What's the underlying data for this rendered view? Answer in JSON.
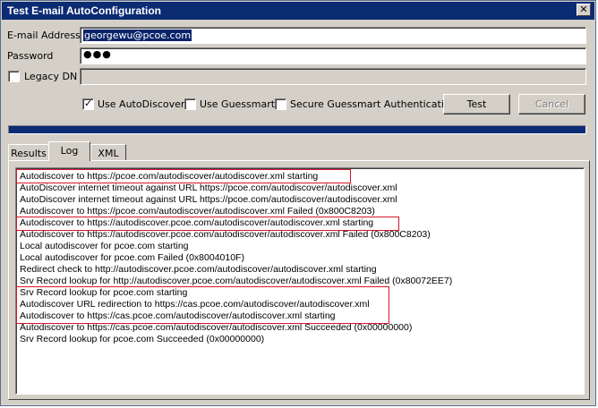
{
  "window": {
    "title": "Test E-mail AutoConfiguration",
    "close_glyph": "✕"
  },
  "form": {
    "email_label": "E-mail Address",
    "email_value": "georgewu@pcoe.com",
    "password_label": "Password",
    "password_value": "●●●",
    "legacy_dn_label": "Legacy DN",
    "legacy_dn_checked": false,
    "legacy_dn_value": ""
  },
  "options": {
    "use_autodiscover_label": "Use AutoDiscover",
    "use_autodiscover_checked": true,
    "use_guessmart_label": "Use Guessmart",
    "use_guessmart_checked": false,
    "secure_guessmart_label": "Secure Guessmart Authentication",
    "secure_guessmart_checked": false,
    "check_glyph": "✓"
  },
  "buttons": {
    "test_label": "Test",
    "cancel_label": "Cancel"
  },
  "progress": {
    "fraction": 1.0
  },
  "tabs": [
    {
      "label": "Results",
      "active": false
    },
    {
      "label": "Log",
      "active": true
    },
    {
      "label": "XML",
      "active": false
    }
  ],
  "log": {
    "lines": [
      "Autodiscover to https://pcoe.com/autodiscover/autodiscover.xml starting",
      "AutoDiscover internet timeout against URL https://pcoe.com/autodiscover/autodiscover.xml",
      "AutoDiscover internet timeout against URL https://pcoe.com/autodiscover/autodiscover.xml",
      "Autodiscover to https://pcoe.com/autodiscover/autodiscover.xml Failed (0x800C8203)",
      "Autodiscover to https://autodiscover.pcoe.com/autodiscover/autodiscover.xml starting",
      "Autodiscover to https://autodiscover.pcoe.com/autodiscover/autodiscover.xml Failed (0x800C8203)",
      "Local autodiscover for pcoe.com starting",
      "Local autodiscover for pcoe.com Failed (0x8004010F)",
      "Redirect check to http://autodiscover.pcoe.com/autodiscover/autodiscover.xml starting",
      "Srv Record lookup for http://autodiscover.pcoe.com/autodiscover/autodiscover.xml Failed (0x80072EE7)",
      "Srv Record lookup for pcoe.com starting",
      "Autodiscover URL redirection to https://cas.pcoe.com/autodiscover/autodiscover.xml",
      "Autodiscover to https://cas.pcoe.com/autodiscover/autodiscover.xml starting",
      "Autodiscover to https://cas.pcoe.com/autodiscover/autodiscover.xml Succeeded (0x00000000)",
      "Srv Record lookup for pcoe.com Succeeded (0x00000000)"
    ]
  },
  "annotation_color": "#d9152c"
}
